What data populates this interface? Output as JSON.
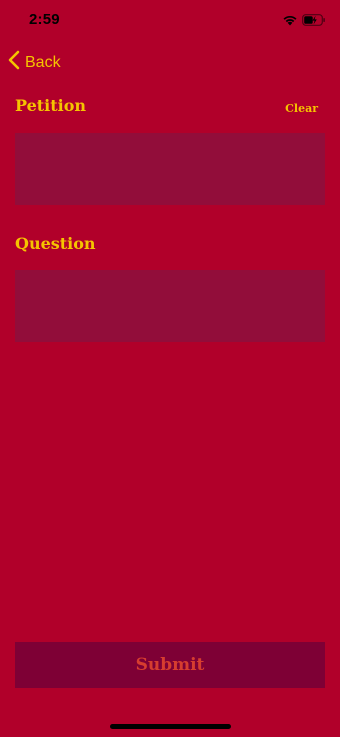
{
  "status_bar": {
    "time": "2:59"
  },
  "nav": {
    "back_label": "Back"
  },
  "petition": {
    "title": "Petition",
    "clear_label": "Clear",
    "value": "",
    "placeholder": ""
  },
  "question": {
    "title": "Question",
    "value": "",
    "placeholder": ""
  },
  "submit": {
    "label": "Submit"
  },
  "colors": {
    "background": "#b1002a",
    "accent": "#f5c400",
    "field": "#920d3a",
    "button": "#7e0035",
    "button_text": "#d63d2f"
  }
}
